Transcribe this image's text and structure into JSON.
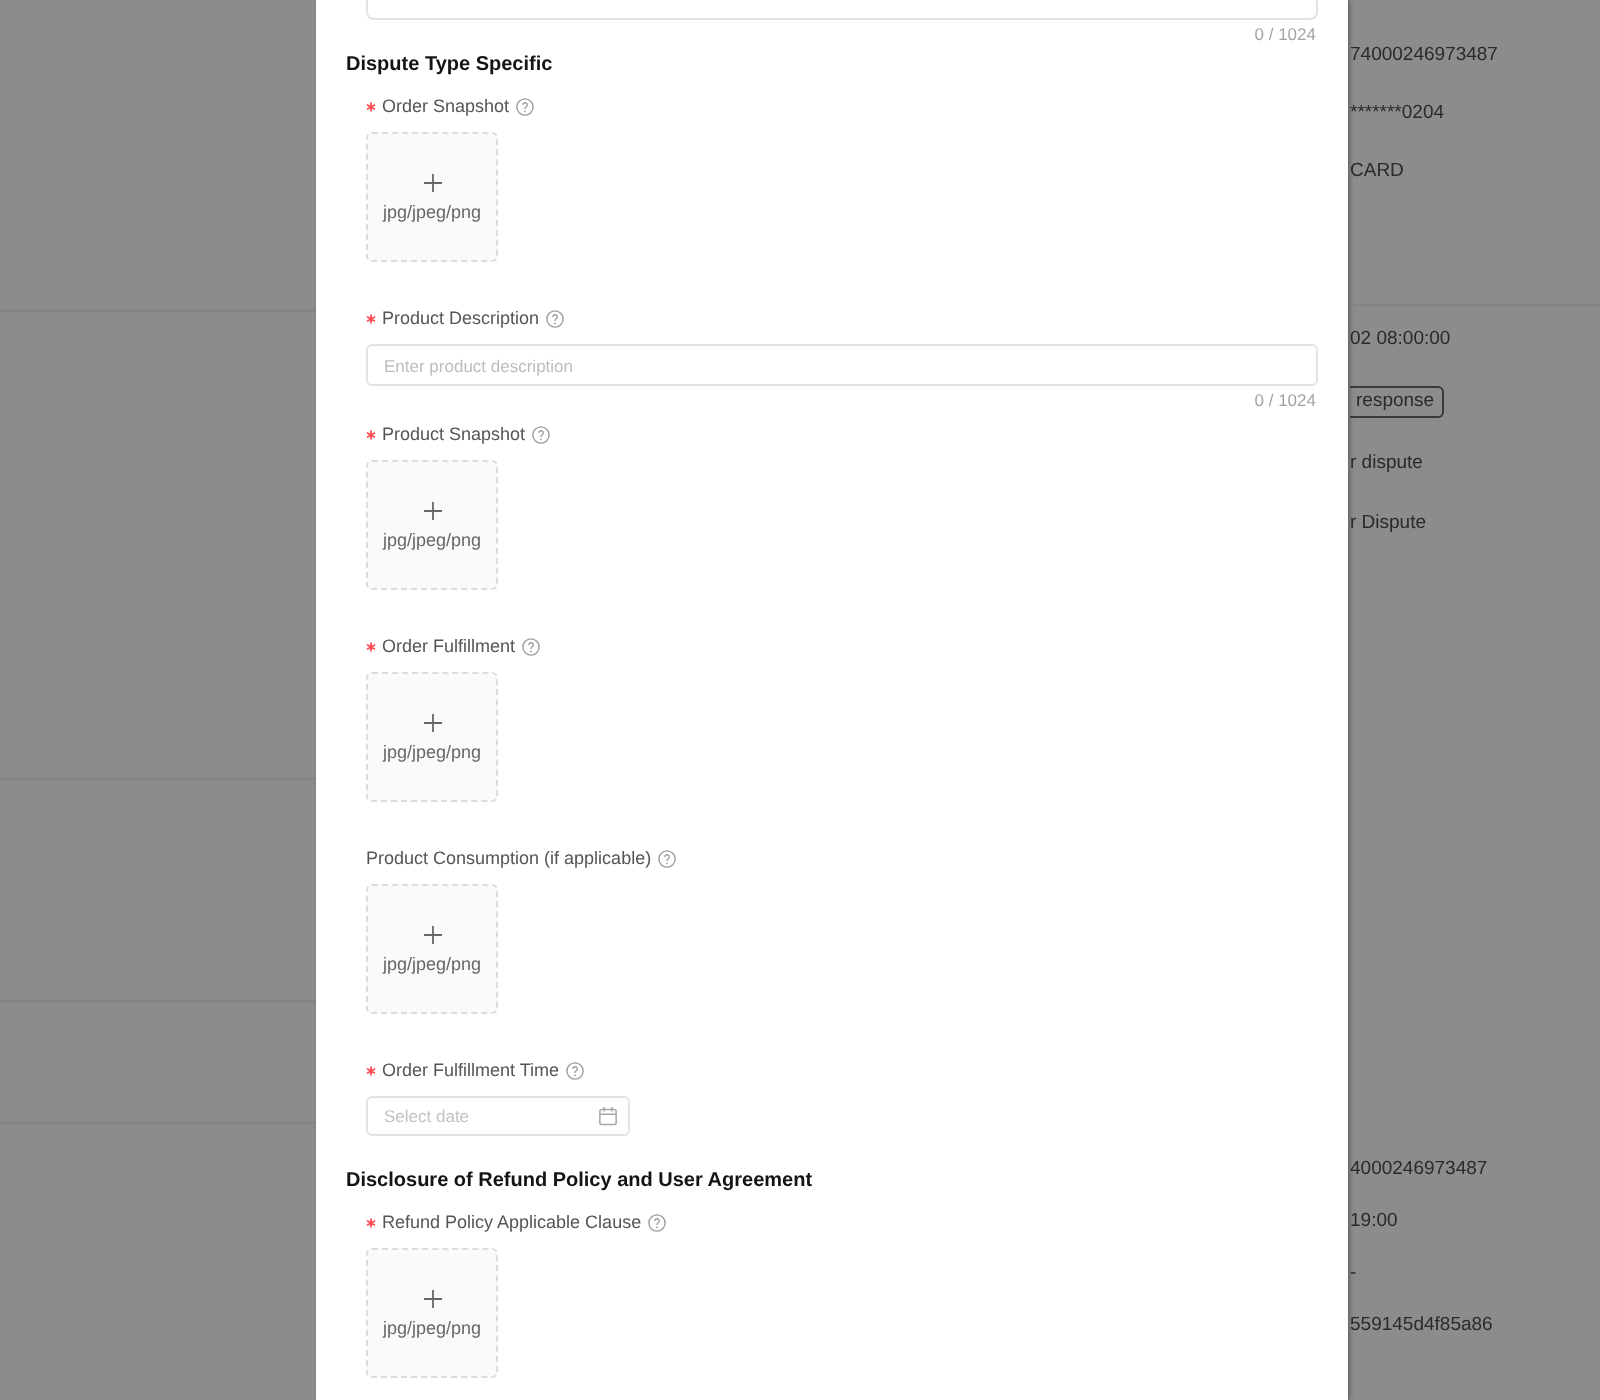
{
  "background_page": {
    "detail_groups": [
      {
        "items": [
          {
            "kind": "text",
            "text": "74000246973487"
          },
          {
            "kind": "text",
            "text": "*******0204"
          },
          {
            "kind": "text",
            "text": "CARD"
          }
        ]
      },
      {
        "items": [
          {
            "kind": "text",
            "text": "02 08:00:00"
          },
          {
            "kind": "button",
            "text": "response"
          },
          {
            "kind": "text",
            "text": "r dispute"
          },
          {
            "kind": "text",
            "text": "r Dispute"
          }
        ]
      },
      {
        "items": [
          {
            "kind": "text",
            "text": "4000246973487"
          },
          {
            "kind": "text",
            "text": "19:00"
          },
          {
            "kind": "text",
            "text": "-"
          },
          {
            "kind": "text",
            "text": "559145d4f85a86"
          }
        ]
      }
    ]
  },
  "dialog": {
    "previous_field": {
      "counter": "0 / 1024"
    },
    "sections": [
      {
        "title": "Dispute Type Specific",
        "fields": [
          {
            "kind": "upload",
            "label": "Order Snapshot",
            "required": true,
            "hint": "jpg/jpeg/png"
          },
          {
            "kind": "textarea",
            "label": "Product Description",
            "required": true,
            "placeholder": "Enter product description",
            "counter": "0 / 1024"
          },
          {
            "kind": "upload",
            "label": "Product Snapshot",
            "required": true,
            "hint": "jpg/jpeg/png"
          },
          {
            "kind": "upload",
            "label": "Order Fulfillment",
            "required": true,
            "hint": "jpg/jpeg/png"
          },
          {
            "kind": "upload",
            "label": "Product Consumption (if applicable)",
            "required": false,
            "hint": "jpg/jpeg/png"
          },
          {
            "kind": "date",
            "label": "Order Fulfillment Time",
            "required": true,
            "placeholder": "Select date"
          }
        ]
      },
      {
        "title": "Disclosure of Refund Policy and User Agreement",
        "fields": [
          {
            "kind": "upload",
            "label": "Refund Policy Applicable Clause",
            "required": true,
            "hint": "jpg/jpeg/png"
          }
        ]
      }
    ]
  }
}
